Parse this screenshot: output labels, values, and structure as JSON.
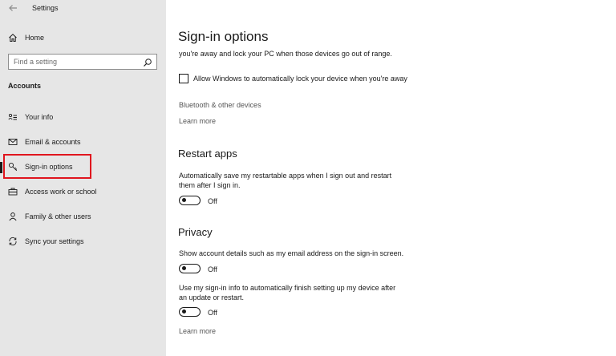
{
  "titlebar": {
    "title": "Settings",
    "back_icon": "back-arrow-icon"
  },
  "sidebar": {
    "home": {
      "label": "Home",
      "icon": "home-icon"
    },
    "search": {
      "placeholder": "Find a setting",
      "icon": "search-icon"
    },
    "section_heading": "Accounts",
    "items": [
      {
        "label": "Your info",
        "icon": "person-card-icon"
      },
      {
        "label": "Email & accounts",
        "icon": "mail-icon"
      },
      {
        "label": "Sign-in options",
        "icon": "key-icon",
        "selected": true
      },
      {
        "label": "Access work or school",
        "icon": "briefcase-icon"
      },
      {
        "label": "Family & other users",
        "icon": "person-icon"
      },
      {
        "label": "Sync your settings",
        "icon": "sync-icon"
      }
    ]
  },
  "main": {
    "title": "Sign-in options",
    "dynamic_lock": {
      "description_tail": "you're away and lock your PC when those devices go out of range.",
      "checkbox_label": "Allow Windows to automatically lock your device when you're away",
      "checkbox_checked": false,
      "bluetooth_link": "Bluetooth & other devices",
      "learn_more": "Learn more"
    },
    "restart_apps": {
      "heading": "Restart apps",
      "description_line1": "Automatically save my restartable apps when I sign out and restart",
      "description_line2": "them after I sign in.",
      "toggle_state": "Off"
    },
    "privacy": {
      "heading": "Privacy",
      "account_details": "Show account details such as my email address on the sign-in screen.",
      "account_details_toggle": "Off",
      "signin_info_line1": "Use my sign-in info to automatically finish setting up my device after",
      "signin_info_line2": "an update or restart.",
      "signin_info_toggle": "Off",
      "learn_more": "Learn more"
    }
  }
}
